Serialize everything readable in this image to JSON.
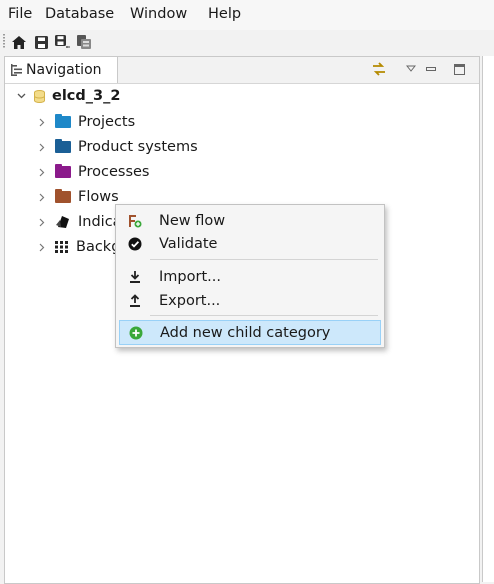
{
  "menubar": {
    "items": [
      "File",
      "Database",
      "Window",
      "Help"
    ]
  },
  "toolbar": {
    "buttons": [
      "home-icon",
      "save-icon",
      "save-all-icon",
      "database-icon"
    ]
  },
  "navigation": {
    "tab_label": "Navigation",
    "view_buttons": [
      "link-with-editor-icon",
      "view-menu-icon",
      "minimize-icon",
      "maximize-icon"
    ],
    "tree": {
      "root": {
        "label": "elcd_3_2",
        "expanded": true
      },
      "children": [
        {
          "label": "Projects",
          "color": "#1e88c8"
        },
        {
          "label": "Product systems",
          "color": "#1b5f96"
        },
        {
          "label": "Processes",
          "color": "#8b1a8b"
        },
        {
          "label": "Flows",
          "color": "#a0522d"
        },
        {
          "label": "Indica"
        },
        {
          "label": "Backg"
        }
      ]
    }
  },
  "context_menu": {
    "items": [
      {
        "label": "New flow",
        "icon": "new-flow-icon"
      },
      {
        "label": "Validate",
        "icon": "check-circle-icon"
      },
      {
        "label": "Import...",
        "icon": "import-icon"
      },
      {
        "label": "Export...",
        "icon": "export-icon"
      },
      {
        "label": "Add new child category",
        "icon": "add-category-icon",
        "highlighted": true
      }
    ],
    "highlight_color": "#cde8fb"
  }
}
